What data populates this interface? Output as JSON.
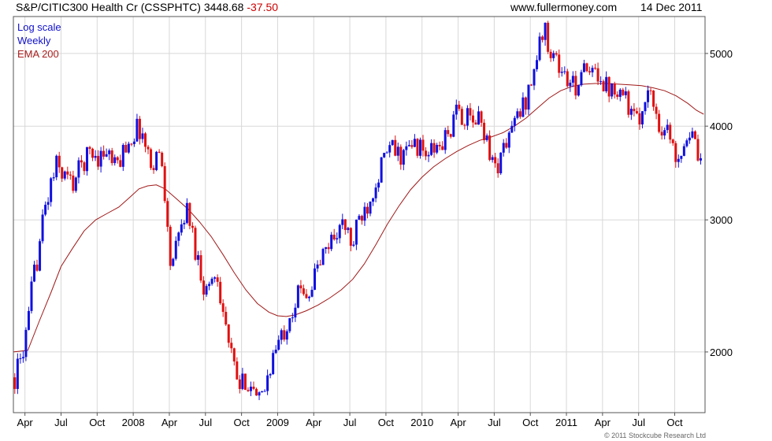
{
  "header": {
    "instrument": "S&P/CITIC300 Health Cr (CSSPHTC)",
    "last": "3448.68",
    "change": "-37.50",
    "website": "www.fullermoney.com",
    "date": "14 Dec 2011"
  },
  "legend": {
    "scale": "Log scale",
    "period": "Weekly",
    "ema": "EMA 200"
  },
  "copyright": "© 2011 Stockcube Research Ltd",
  "colors": {
    "up": "#1010e0",
    "down": "#e01010",
    "ema": "#a01818",
    "grid": "#d8d8d8",
    "frame": "#555555",
    "change": "#cc0000",
    "legend_blue": "#1010cc",
    "legend_red": "#aa2020"
  },
  "chart_data": {
    "type": "candlestick",
    "scale": "log",
    "ylim": [
      1660,
      5600
    ],
    "xlim": [
      2007.17,
      2011.96
    ],
    "y_ticks": [
      2000,
      3000,
      4000,
      5000
    ],
    "y_tick_labels": [
      "2000",
      "3000",
      "4000",
      "5000"
    ],
    "x_ticks": [
      2007.25,
      2007.5,
      2007.75,
      2008.0,
      2008.25,
      2008.5,
      2008.75,
      2009.0,
      2009.25,
      2009.5,
      2009.75,
      2010.0,
      2010.25,
      2010.5,
      2010.75,
      2011.0,
      2011.25,
      2011.5,
      2011.75
    ],
    "x_tick_labels": [
      "Apr",
      "Jul",
      "Oct",
      "2008",
      "Apr",
      "Jul",
      "Oct",
      "2009",
      "Apr",
      "Jul",
      "Oct",
      "2010",
      "Apr",
      "Jul",
      "Oct",
      "2011",
      "Apr",
      "Jul",
      "Oct"
    ],
    "grid": true,
    "legend_position": "top-left",
    "path": [
      [
        2007.18,
        1850
      ],
      [
        2007.22,
        1950
      ],
      [
        2007.27,
        2150
      ],
      [
        2007.3,
        2450
      ],
      [
        2007.34,
        2700
      ],
      [
        2007.38,
        3050
      ],
      [
        2007.43,
        3350
      ],
      [
        2007.47,
        3550
      ],
      [
        2007.52,
        3450
      ],
      [
        2007.58,
        3350
      ],
      [
        2007.64,
        3550
      ],
      [
        2007.7,
        3700
      ],
      [
        2007.76,
        3650
      ],
      [
        2007.82,
        3700
      ],
      [
        2007.88,
        3500
      ],
      [
        2007.94,
        3750
      ],
      [
        2008.0,
        3900
      ],
      [
        2008.04,
        4000
      ],
      [
        2008.08,
        3800
      ],
      [
        2008.12,
        3550
      ],
      [
        2008.17,
        3700
      ],
      [
        2008.21,
        3500
      ],
      [
        2008.23,
        3000
      ],
      [
        2008.26,
        2600
      ],
      [
        2008.3,
        2750
      ],
      [
        2008.35,
        3050
      ],
      [
        2008.38,
        3100
      ],
      [
        2008.42,
        2800
      ],
      [
        2008.46,
        2600
      ],
      [
        2008.5,
        2400
      ],
      [
        2008.54,
        2500
      ],
      [
        2008.58,
        2550
      ],
      [
        2008.62,
        2300
      ],
      [
        2008.66,
        2050
      ],
      [
        2008.7,
        1900
      ],
      [
        2008.74,
        1780
      ],
      [
        2008.78,
        1850
      ],
      [
        2008.82,
        1800
      ],
      [
        2008.86,
        1700
      ],
      [
        2008.9,
        1750
      ],
      [
        2008.94,
        1900
      ],
      [
        2008.98,
        2000
      ],
      [
        2009.03,
        2100
      ],
      [
        2009.08,
        2250
      ],
      [
        2009.13,
        2350
      ],
      [
        2009.17,
        2450
      ],
      [
        2009.22,
        2400
      ],
      [
        2009.26,
        2550
      ],
      [
        2009.32,
        2700
      ],
      [
        2009.38,
        2850
      ],
      [
        2009.44,
        2950
      ],
      [
        2009.48,
        2900
      ],
      [
        2009.52,
        2750
      ],
      [
        2009.56,
        3000
      ],
      [
        2009.62,
        3150
      ],
      [
        2009.67,
        3350
      ],
      [
        2009.72,
        3550
      ],
      [
        2009.78,
        3750
      ],
      [
        2009.84,
        3650
      ],
      [
        2009.9,
        3700
      ],
      [
        2009.96,
        3800
      ],
      [
        2010.02,
        3650
      ],
      [
        2010.07,
        3700
      ],
      [
        2010.12,
        3750
      ],
      [
        2010.18,
        3900
      ],
      [
        2010.25,
        4200
      ],
      [
        2010.3,
        4100
      ],
      [
        2010.35,
        4050
      ],
      [
        2010.4,
        4100
      ],
      [
        2010.45,
        3850
      ],
      [
        2010.5,
        3500
      ],
      [
        2010.55,
        3650
      ],
      [
        2010.6,
        3900
      ],
      [
        2010.66,
        4100
      ],
      [
        2010.72,
        4350
      ],
      [
        2010.78,
        4800
      ],
      [
        2010.84,
        5400
      ],
      [
        2010.88,
        5150
      ],
      [
        2010.92,
        4950
      ],
      [
        2010.96,
        4750
      ],
      [
        2011.02,
        4550
      ],
      [
        2011.06,
        4500
      ],
      [
        2011.1,
        4750
      ],
      [
        2011.16,
        4650
      ],
      [
        2011.22,
        4750
      ],
      [
        2011.28,
        4500
      ],
      [
        2011.34,
        4550
      ],
      [
        2011.4,
        4450
      ],
      [
        2011.45,
        4150
      ],
      [
        2011.5,
        4000
      ],
      [
        2011.55,
        4500
      ],
      [
        2011.6,
        4300
      ],
      [
        2011.65,
        4000
      ],
      [
        2011.7,
        3950
      ],
      [
        2011.75,
        3650
      ],
      [
        2011.8,
        3750
      ],
      [
        2011.85,
        3950
      ],
      [
        2011.9,
        3700
      ],
      [
        2011.94,
        3450
      ]
    ],
    "ema": [
      [
        2007.17,
        2000
      ],
      [
        2007.27,
        2010
      ],
      [
        2007.35,
        2200
      ],
      [
        2007.43,
        2400
      ],
      [
        2007.5,
        2600
      ],
      [
        2007.58,
        2750
      ],
      [
        2007.66,
        2900
      ],
      [
        2007.74,
        3000
      ],
      [
        2007.82,
        3060
      ],
      [
        2007.9,
        3120
      ],
      [
        2007.98,
        3220
      ],
      [
        2008.04,
        3300
      ],
      [
        2008.1,
        3330
      ],
      [
        2008.16,
        3340
      ],
      [
        2008.22,
        3300
      ],
      [
        2008.3,
        3200
      ],
      [
        2008.38,
        3100
      ],
      [
        2008.46,
        2980
      ],
      [
        2008.54,
        2850
      ],
      [
        2008.62,
        2700
      ],
      [
        2008.7,
        2550
      ],
      [
        2008.78,
        2420
      ],
      [
        2008.86,
        2320
      ],
      [
        2008.94,
        2260
      ],
      [
        2009.0,
        2235
      ],
      [
        2009.06,
        2230
      ],
      [
        2009.12,
        2240
      ],
      [
        2009.2,
        2270
      ],
      [
        2009.28,
        2310
      ],
      [
        2009.36,
        2360
      ],
      [
        2009.44,
        2420
      ],
      [
        2009.52,
        2500
      ],
      [
        2009.6,
        2620
      ],
      [
        2009.68,
        2780
      ],
      [
        2009.76,
        2960
      ],
      [
        2009.84,
        3130
      ],
      [
        2009.92,
        3290
      ],
      [
        2010.0,
        3420
      ],
      [
        2010.08,
        3530
      ],
      [
        2010.16,
        3620
      ],
      [
        2010.24,
        3700
      ],
      [
        2010.32,
        3770
      ],
      [
        2010.4,
        3830
      ],
      [
        2010.48,
        3870
      ],
      [
        2010.56,
        3920
      ],
      [
        2010.64,
        4000
      ],
      [
        2010.72,
        4100
      ],
      [
        2010.8,
        4230
      ],
      [
        2010.88,
        4360
      ],
      [
        2010.96,
        4460
      ],
      [
        2011.04,
        4520
      ],
      [
        2011.12,
        4550
      ],
      [
        2011.2,
        4560
      ],
      [
        2011.28,
        4560
      ],
      [
        2011.36,
        4550
      ],
      [
        2011.44,
        4540
      ],
      [
        2011.52,
        4530
      ],
      [
        2011.6,
        4500
      ],
      [
        2011.68,
        4460
      ],
      [
        2011.76,
        4390
      ],
      [
        2011.84,
        4290
      ],
      [
        2011.9,
        4200
      ],
      [
        2011.95,
        4150
      ]
    ]
  }
}
